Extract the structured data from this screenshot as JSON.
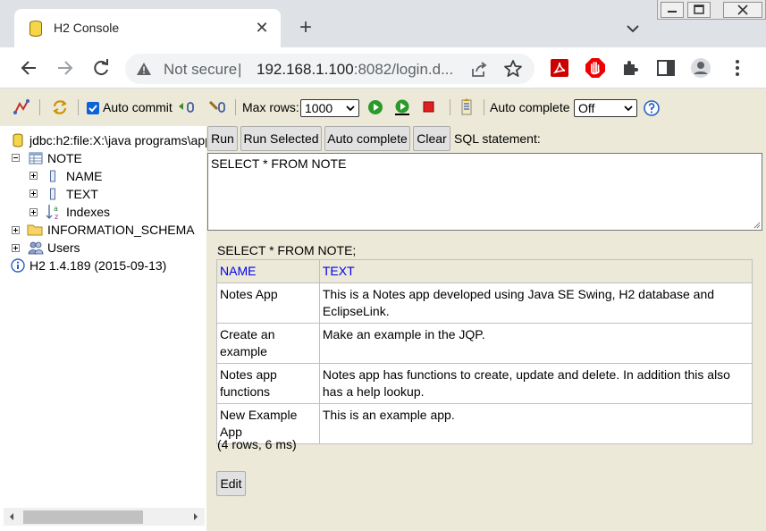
{
  "browser": {
    "tab_title": "H2 Console",
    "tab_close": "✕",
    "new_tab": "+",
    "security_label": "Not secure",
    "separator": "|",
    "url_host": "192.168.1.100",
    "url_rest": ":8082/login.d..."
  },
  "toolbar": {
    "auto_commit_label": "Auto commit",
    "max_rows_label": "Max rows:",
    "max_rows_value": "1000",
    "auto_complete_label": "Auto complete",
    "auto_complete_value": "Off"
  },
  "tree": {
    "connection": "jdbc:h2:file:X:\\java programs\\app",
    "table": "NOTE",
    "columns": [
      "NAME",
      "TEXT"
    ],
    "indexes": "Indexes",
    "schema": "INFORMATION_SCHEMA",
    "users": "Users",
    "version": "H2 1.4.189 (2015-09-13)"
  },
  "query": {
    "run": "Run",
    "run_selected": "Run Selected",
    "auto_complete": "Auto complete",
    "clear": "Clear",
    "label": "SQL statement:",
    "sql": "SELECT * FROM NOTE"
  },
  "result": {
    "statement": "SELECT * FROM NOTE;",
    "headers": [
      "NAME",
      "TEXT"
    ],
    "rows": [
      [
        "Notes App",
        "This is a Notes app developed using Java SE Swing, H2 database and EclipseLink."
      ],
      [
        "Create an example",
        "Make an example in the JQP."
      ],
      [
        "Notes app functions",
        "Notes app has functions to create, update and delete. In addition this also has a help lookup."
      ],
      [
        "New Example App",
        "This is an example app."
      ]
    ],
    "summary": "(4 rows, 6 ms)",
    "edit": "Edit"
  },
  "colors": {
    "h2_background": "#ece9d8",
    "header_link": "#0000ee",
    "checkbox": "#0a64d8"
  }
}
